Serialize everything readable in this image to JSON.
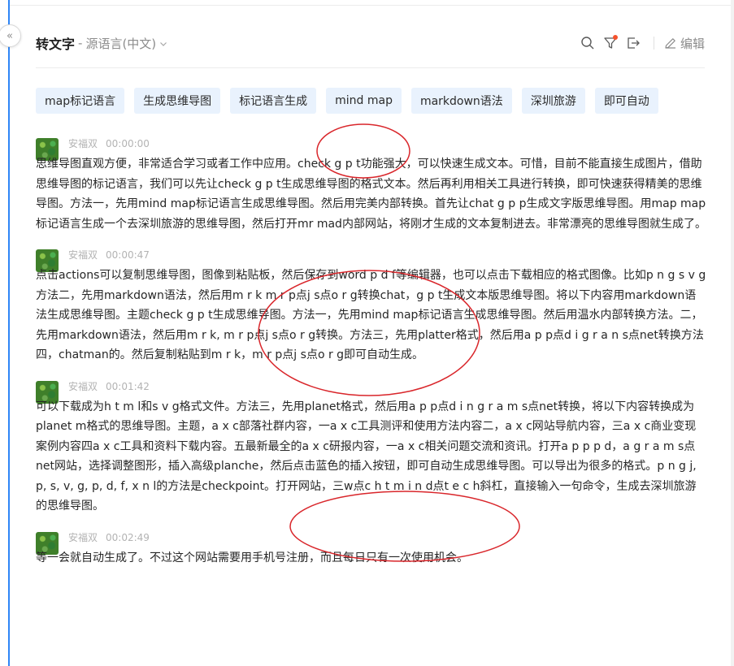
{
  "header": {
    "title": "转文字",
    "separator": "-",
    "language": "源语言(中文)",
    "edit_label": "编辑"
  },
  "icons": {
    "collapse": "double-chevron-left-icon",
    "search": "search-icon",
    "filter": "filter-icon",
    "export": "export-icon",
    "edit": "pencil-icon"
  },
  "colors": {
    "accent": "#2f86f6",
    "tag_bg": "#e9f2fd",
    "annotation": "#d9262b",
    "badge": "#f5512c"
  },
  "tags": [
    "map标记语言",
    "生成思维导图",
    "标记语言生成",
    "mind map",
    "markdown语法",
    "深圳旅游",
    "即可自动"
  ],
  "segments": [
    {
      "speaker": "安福双",
      "time": "00:00:00",
      "text": "思维导图直观方便，非常适合学习或者工作中应用。check g p t功能强大，可以快速生成文本。可惜，目前不能直接生成图片，借助思维导图的标记语言，我们可以先让check g p t生成思维导图的格式文本。然后再利用相关工具进行转换，即可快速获得精美的思维导图。方法一，先用mind map标记语言生成思维导图。然后用完美内部转换。首先让chat g p p生成文字版思维导图。用map map标记语言生成一个去深圳旅游的思维导图，然后打开mr mad内部网站，将刚才生成的文本复制进去。非常漂亮的思维导图就生成了。"
    },
    {
      "speaker": "安福双",
      "time": "00:00:47",
      "text": "点击actions可以复制思维导图，图像到粘贴板，然后保存到word p d f等编辑器，也可以点击下载相应的格式图像。比如p n g s v g方法二，先用markdown语法，然后用m r k m r p点j s点o r g转换chat，g p t生成文本版思维导图。将以下内容用markdown语法生成思维导图。主题check g p t生成思维导图。方法一，先用mind map标记语言生成思维导图。然后用温水内部转换方法。二，先用markdown语法，然后用m r k, m r p点j s点o r g转换。方法三，先用platter格式，然后用a p p点d i g r a n s点net转换方法四，chatman的。然后复制粘贴到m r k，m r p点j s点o r g即可自动生成。"
    },
    {
      "speaker": "安福双",
      "time": "00:01:42",
      "text": "可以下载成为h t m l和s v g格式文件。方法三，先用planet格式，然后用a p p点d i n g r a m s点net转换，将以下内容转换成为planet m格式的思维导图。主题，a x c部落社群内容，一a x c工具测评和使用方法内容二，a x c网站导航内容，三a x c商业变现案例内容四a x c工具和资料下载内容。五最新最全的a x c研报内容，一a x c相关问题交流和资讯。打开a p p p d，a g r a m s点net网站，选择调整图形，插入高级planche，然后点击蓝色的插入按钮，即可自动生成思维导图。可以导出为很多的格式。p n g j, p, s, v, g, p, d, f, x n l的方法是checkpoint。打开网站，三w点c h t m i n d点t e c h斜杠，直接输入一句命令，生成去深圳旅游的思维导图。"
    },
    {
      "speaker": "安福双",
      "time": "00:02:49",
      "text": "等一会就自动生成了。不过这个网站需要用手机号注册，而且每日只有一次使用机会。"
    }
  ]
}
